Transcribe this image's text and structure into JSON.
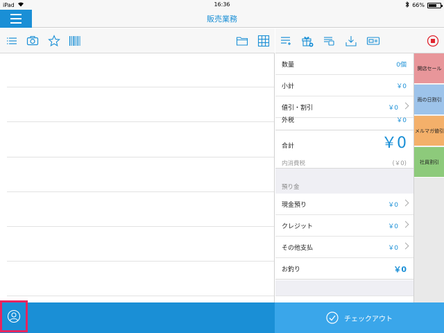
{
  "status_bar": {
    "device": "iPad",
    "time": "16:36",
    "battery": "66%",
    "battery_level": 0.66
  },
  "nav": {
    "title": "販売業務"
  },
  "left_toolbar": {
    "icons": [
      "list-icon",
      "camera-icon",
      "star-icon",
      "barcode-icon",
      "folder-icon",
      "grid-icon"
    ]
  },
  "right_toolbar": {
    "icons": [
      "edit-list-icon",
      "gift-add-icon",
      "receipt-icon",
      "tray-download-icon",
      "card-reader-icon",
      "stop-icon"
    ]
  },
  "summary": {
    "quantity": {
      "label": "数量",
      "value": "0個"
    },
    "subtotal": {
      "label": "小計",
      "value": "￥0"
    },
    "discount": {
      "label": "値引・割引",
      "value": "￥0"
    },
    "outer_tax": {
      "label": "外税",
      "value": "￥0"
    },
    "total": {
      "label": "合計",
      "value": "￥0"
    },
    "inner_tax": {
      "label": "内消費税",
      "value": "(￥0)"
    },
    "deposit_section": "預り金",
    "cash": {
      "label": "現金預り",
      "value": "￥0"
    },
    "credit": {
      "label": "クレジット",
      "value": "￥0"
    },
    "other": {
      "label": "その他支払",
      "value": "￥0"
    },
    "change": {
      "label": "お釣り",
      "value": "￥0"
    }
  },
  "discount_tabs": [
    {
      "label": "開店セール",
      "color": "#e8969a"
    },
    {
      "label": "雨の日割引",
      "color": "#9dc3ea"
    },
    {
      "label": "メルマガ値引",
      "color": "#f4b06a"
    },
    {
      "label": "社員割引",
      "color": "#8dca7b"
    }
  ],
  "checkout": {
    "label": "チェックアウト"
  },
  "colors": {
    "accent": "#1a8fd6",
    "highlight": "#e8245f",
    "stop": "#e0242e"
  }
}
